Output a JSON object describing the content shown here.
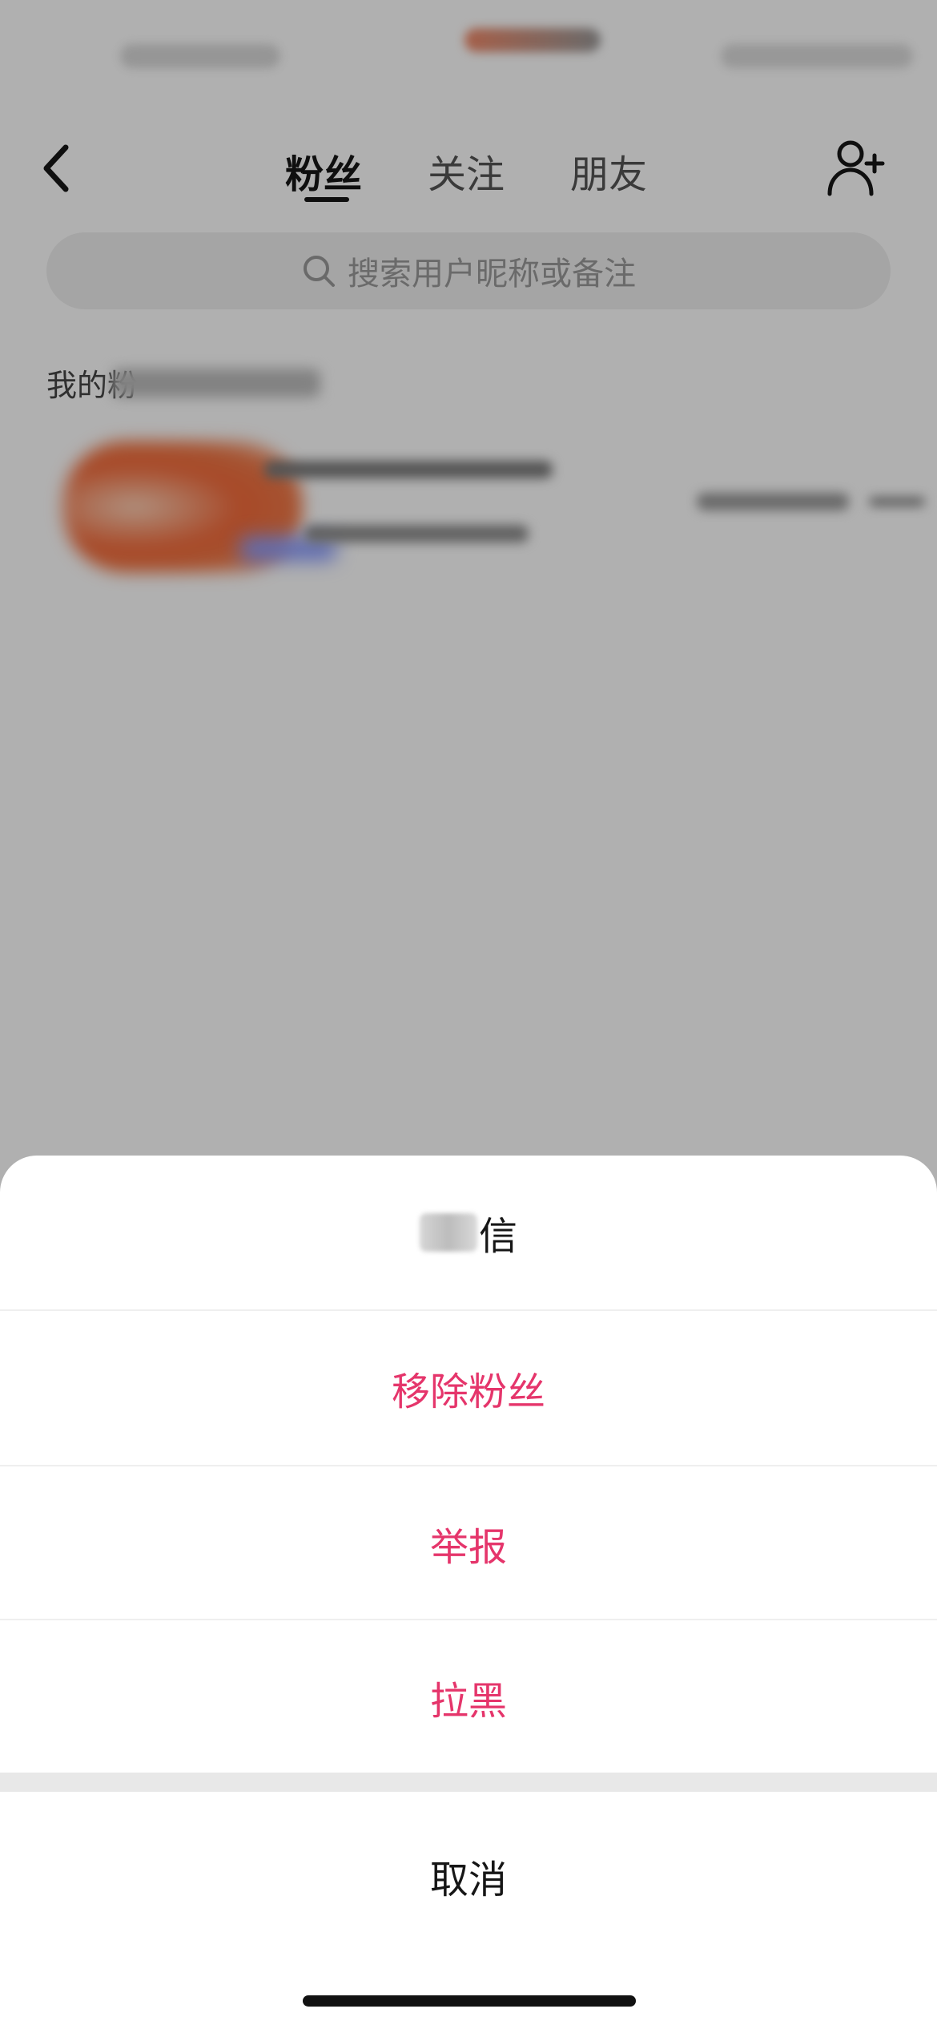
{
  "nav": {
    "tabs": [
      {
        "label": "粉丝",
        "active": true
      },
      {
        "label": "关注",
        "active": false
      },
      {
        "label": "朋友",
        "active": false
      }
    ],
    "back_icon": "chevron-left-icon",
    "add_user_icon": "add-user-icon"
  },
  "search": {
    "placeholder": "搜索用户昵称或备注",
    "icon": "search-icon"
  },
  "section": {
    "label": "我的粉"
  },
  "sheet": {
    "first_item_visible_text": "信",
    "items": [
      {
        "label": "移除粉丝"
      },
      {
        "label": "举报"
      },
      {
        "label": "拉黑"
      }
    ],
    "cancel_label": "取消"
  },
  "colors": {
    "danger": "#e5356b",
    "text": "#161616",
    "placeholder": "#9a9a9a",
    "overlay": "rgba(0,0,0,0.31)"
  }
}
